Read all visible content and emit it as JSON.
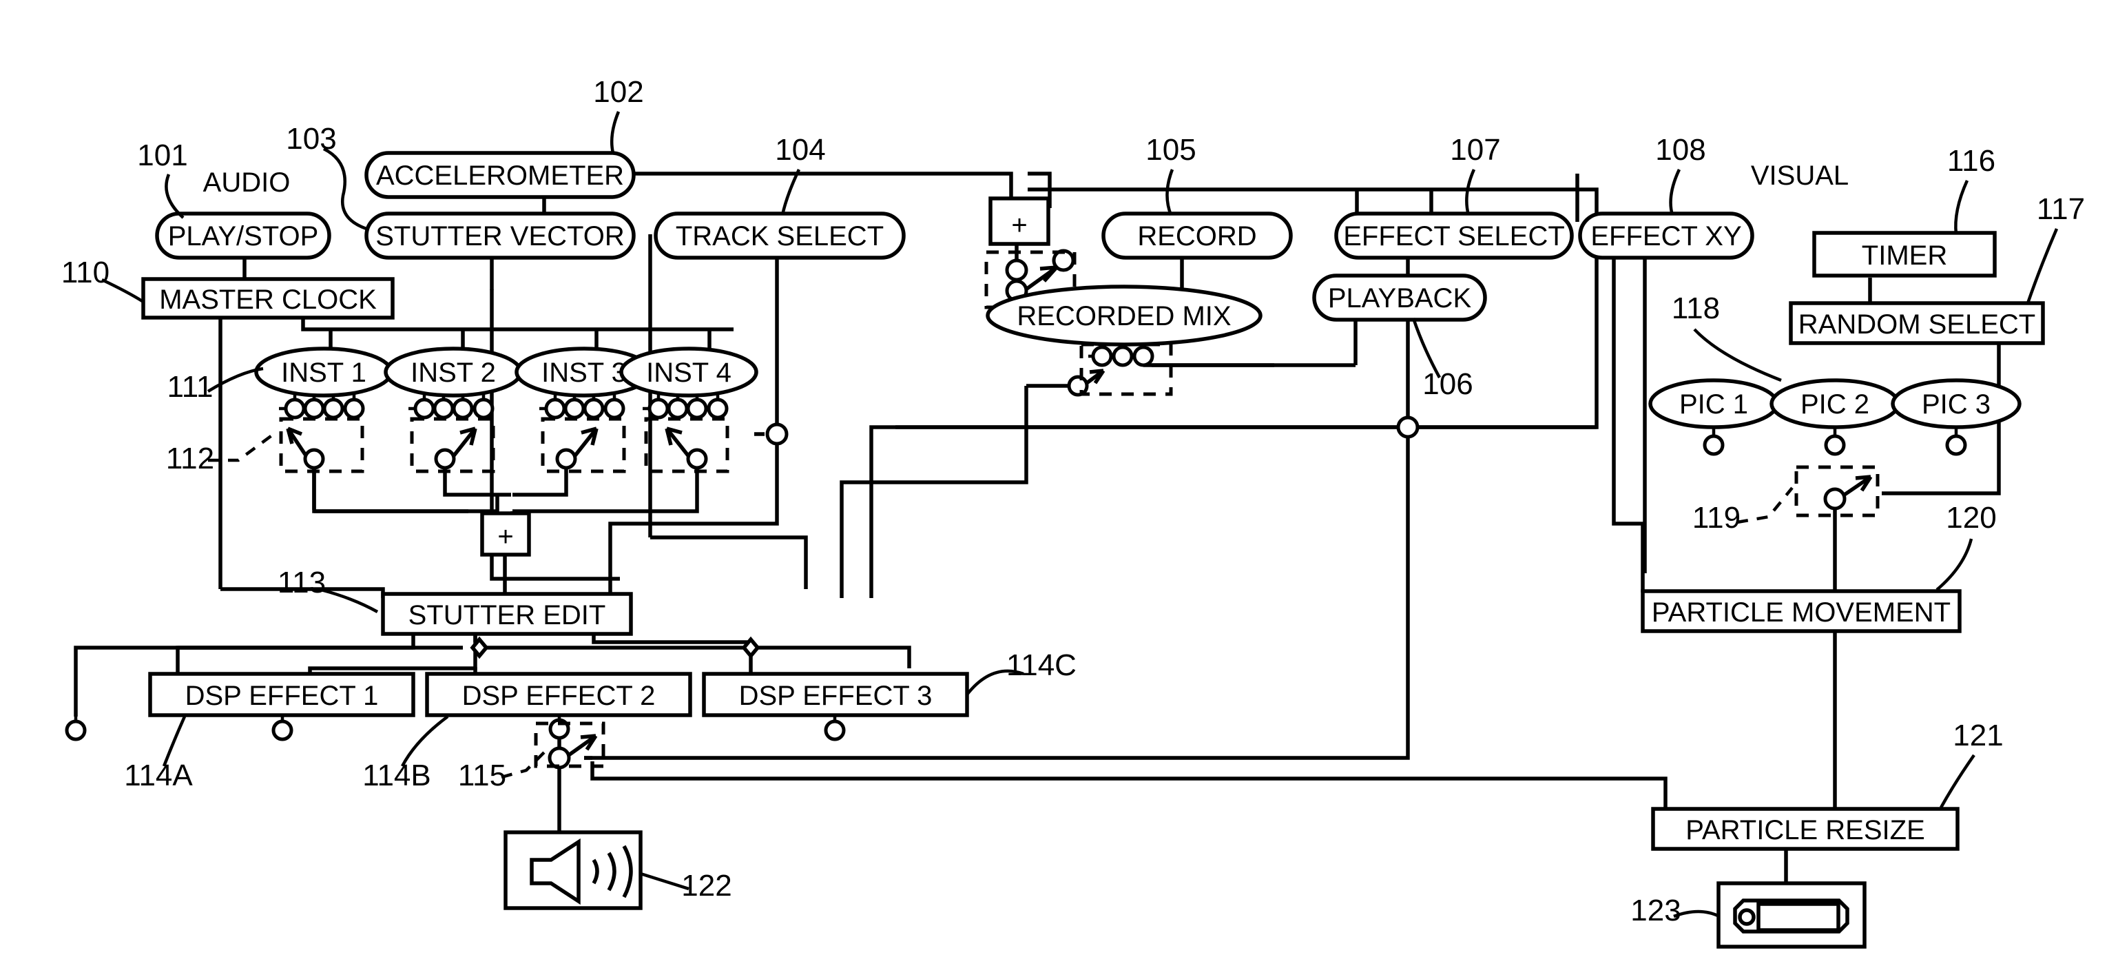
{
  "figure": {
    "section_labels": [
      {
        "id": "audio",
        "text": "AUDIO"
      },
      {
        "id": "visual",
        "text": "VISUAL"
      }
    ],
    "nodes": [
      {
        "id": "play_stop",
        "ref": "101",
        "label": "PLAY/STOP",
        "shape": "stadium"
      },
      {
        "id": "accelerometer",
        "ref": "102",
        "label": "ACCELEROMETER",
        "shape": "stadium"
      },
      {
        "id": "stutter_vector",
        "ref": "103",
        "label": "STUTTER VECTOR",
        "shape": "stadium"
      },
      {
        "id": "track_select",
        "ref": "104",
        "label": "TRACK SELECT",
        "shape": "stadium"
      },
      {
        "id": "record",
        "ref": "105",
        "label": "RECORD",
        "shape": "stadium"
      },
      {
        "id": "playback",
        "ref": "106",
        "label": "PLAYBACK",
        "shape": "stadium"
      },
      {
        "id": "effect_select",
        "ref": "107",
        "label": "EFFECT SELECT",
        "shape": "stadium"
      },
      {
        "id": "effect_xy",
        "ref": "108",
        "label": "EFFECT XY",
        "shape": "stadium"
      },
      {
        "id": "master_clock",
        "ref": "110",
        "label": "MASTER CLOCK",
        "shape": "rect"
      },
      {
        "id": "inst1",
        "ref": "111",
        "label": "INST 1",
        "shape": "ellipse"
      },
      {
        "id": "inst2",
        "ref": "",
        "label": "INST 2",
        "shape": "ellipse"
      },
      {
        "id": "inst3",
        "ref": "",
        "label": "INST 3",
        "shape": "ellipse"
      },
      {
        "id": "inst4",
        "ref": "",
        "label": "INST 4",
        "shape": "ellipse"
      },
      {
        "id": "inst_switch",
        "ref": "112",
        "label": "",
        "shape": "switch"
      },
      {
        "id": "recorded_mix",
        "ref": "",
        "label": "RECORDED MIX",
        "shape": "ellipse"
      },
      {
        "id": "stutter_edit",
        "ref": "113",
        "label": "STUTTER EDIT",
        "shape": "rect"
      },
      {
        "id": "dsp_effect_1",
        "ref": "114A",
        "label": "DSP EFFECT 1",
        "shape": "rect"
      },
      {
        "id": "dsp_effect_2",
        "ref": "114B",
        "label": "DSP EFFECT 2",
        "shape": "rect"
      },
      {
        "id": "dsp_effect_3",
        "ref": "114C",
        "label": "DSP EFFECT 3",
        "shape": "rect"
      },
      {
        "id": "output_switch",
        "ref": "115",
        "label": "",
        "shape": "switch"
      },
      {
        "id": "timer",
        "ref": "116",
        "label": "TIMER",
        "shape": "rect"
      },
      {
        "id": "random_select",
        "ref": "117",
        "label": "RANDOM SELECT",
        "shape": "rect"
      },
      {
        "id": "pic1",
        "ref": "118",
        "label": "PIC 1",
        "shape": "ellipse"
      },
      {
        "id": "pic2",
        "ref": "",
        "label": "PIC 2",
        "shape": "ellipse"
      },
      {
        "id": "pic3",
        "ref": "",
        "label": "PIC 3",
        "shape": "ellipse"
      },
      {
        "id": "pic_switch",
        "ref": "119",
        "label": "",
        "shape": "switch"
      },
      {
        "id": "particle_movement",
        "ref": "120",
        "label": "PARTICLE MOVEMENT",
        "shape": "rect"
      },
      {
        "id": "particle_resize",
        "ref": "121",
        "label": "PARTICLE RESIZE",
        "shape": "rect"
      },
      {
        "id": "speaker",
        "ref": "122",
        "label": "",
        "shape": "icon-box"
      },
      {
        "id": "display",
        "ref": "123",
        "label": "",
        "shape": "icon-box"
      },
      {
        "id": "sum_inst",
        "ref": "",
        "label": "+",
        "shape": "rect"
      },
      {
        "id": "sum_mix",
        "ref": "",
        "label": "+",
        "shape": "rect"
      }
    ],
    "reference_numerals": [
      "101",
      "102",
      "103",
      "104",
      "105",
      "106",
      "107",
      "108",
      "110",
      "111",
      "112",
      "113",
      "114A",
      "114B",
      "114C",
      "115",
      "116",
      "117",
      "118",
      "119",
      "120",
      "121",
      "122",
      "123"
    ],
    "icons": [
      {
        "id": "speaker",
        "name": "speaker-icon",
        "glyph": "loudspeaker with sound waves"
      },
      {
        "id": "display",
        "name": "display-device-icon",
        "glyph": "handheld screen device"
      }
    ],
    "colors": {
      "stroke": "#000000",
      "background": "#ffffff"
    }
  }
}
